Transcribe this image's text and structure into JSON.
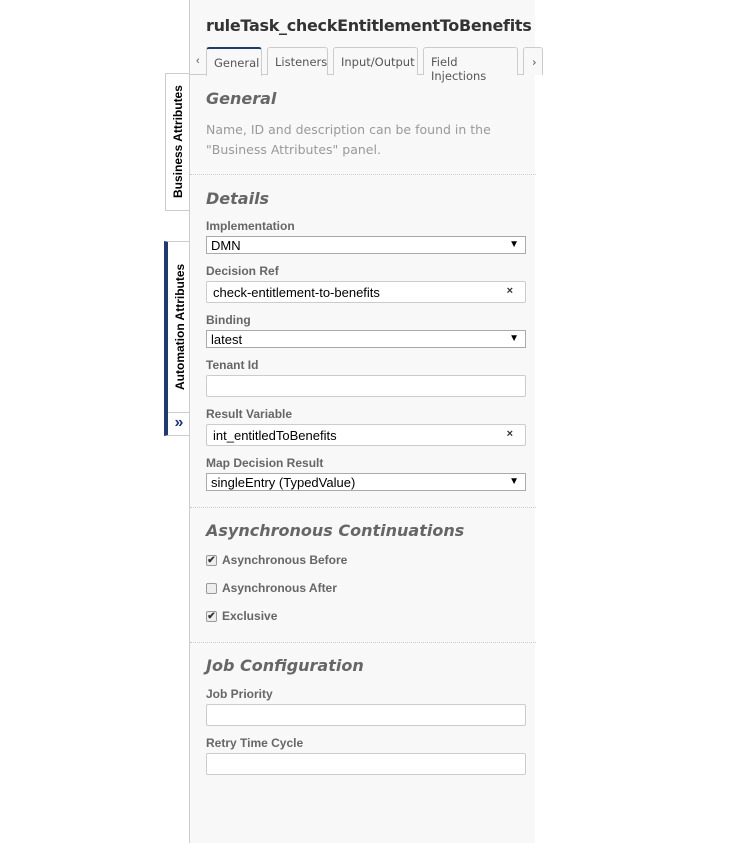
{
  "title": "ruleTask_checkEntitlementToBenefits",
  "tabs": [
    "General",
    "Listeners",
    "Input/Output",
    "Field Injections"
  ],
  "side_tabs": {
    "business": "Business Attributes",
    "automation": "Automation Attributes",
    "collapse": "»"
  },
  "accent": "#1f3a6e",
  "general": {
    "heading": "General",
    "desc": "Name, ID and description can be found in the \"Business Attributes\" panel."
  },
  "details": {
    "heading": "Details",
    "implementation": {
      "label": "Implementation",
      "value": "DMN"
    },
    "decision_ref": {
      "label": "Decision Ref",
      "value": "check-entitlement-to-benefits"
    },
    "binding": {
      "label": "Binding",
      "value": "latest"
    },
    "tenant_id": {
      "label": "Tenant Id",
      "value": ""
    },
    "result_variable": {
      "label": "Result Variable",
      "value": "int_entitledToBenefits"
    },
    "map_decision_result": {
      "label": "Map Decision Result",
      "value": "singleEntry (TypedValue)"
    }
  },
  "async": {
    "heading": "Asynchronous Continuations",
    "before": "Asynchronous Before",
    "after": "Asynchronous After",
    "exclusive": "Exclusive"
  },
  "job": {
    "heading": "Job Configuration",
    "priority": "Job Priority",
    "retry": "Retry Time Cycle"
  }
}
